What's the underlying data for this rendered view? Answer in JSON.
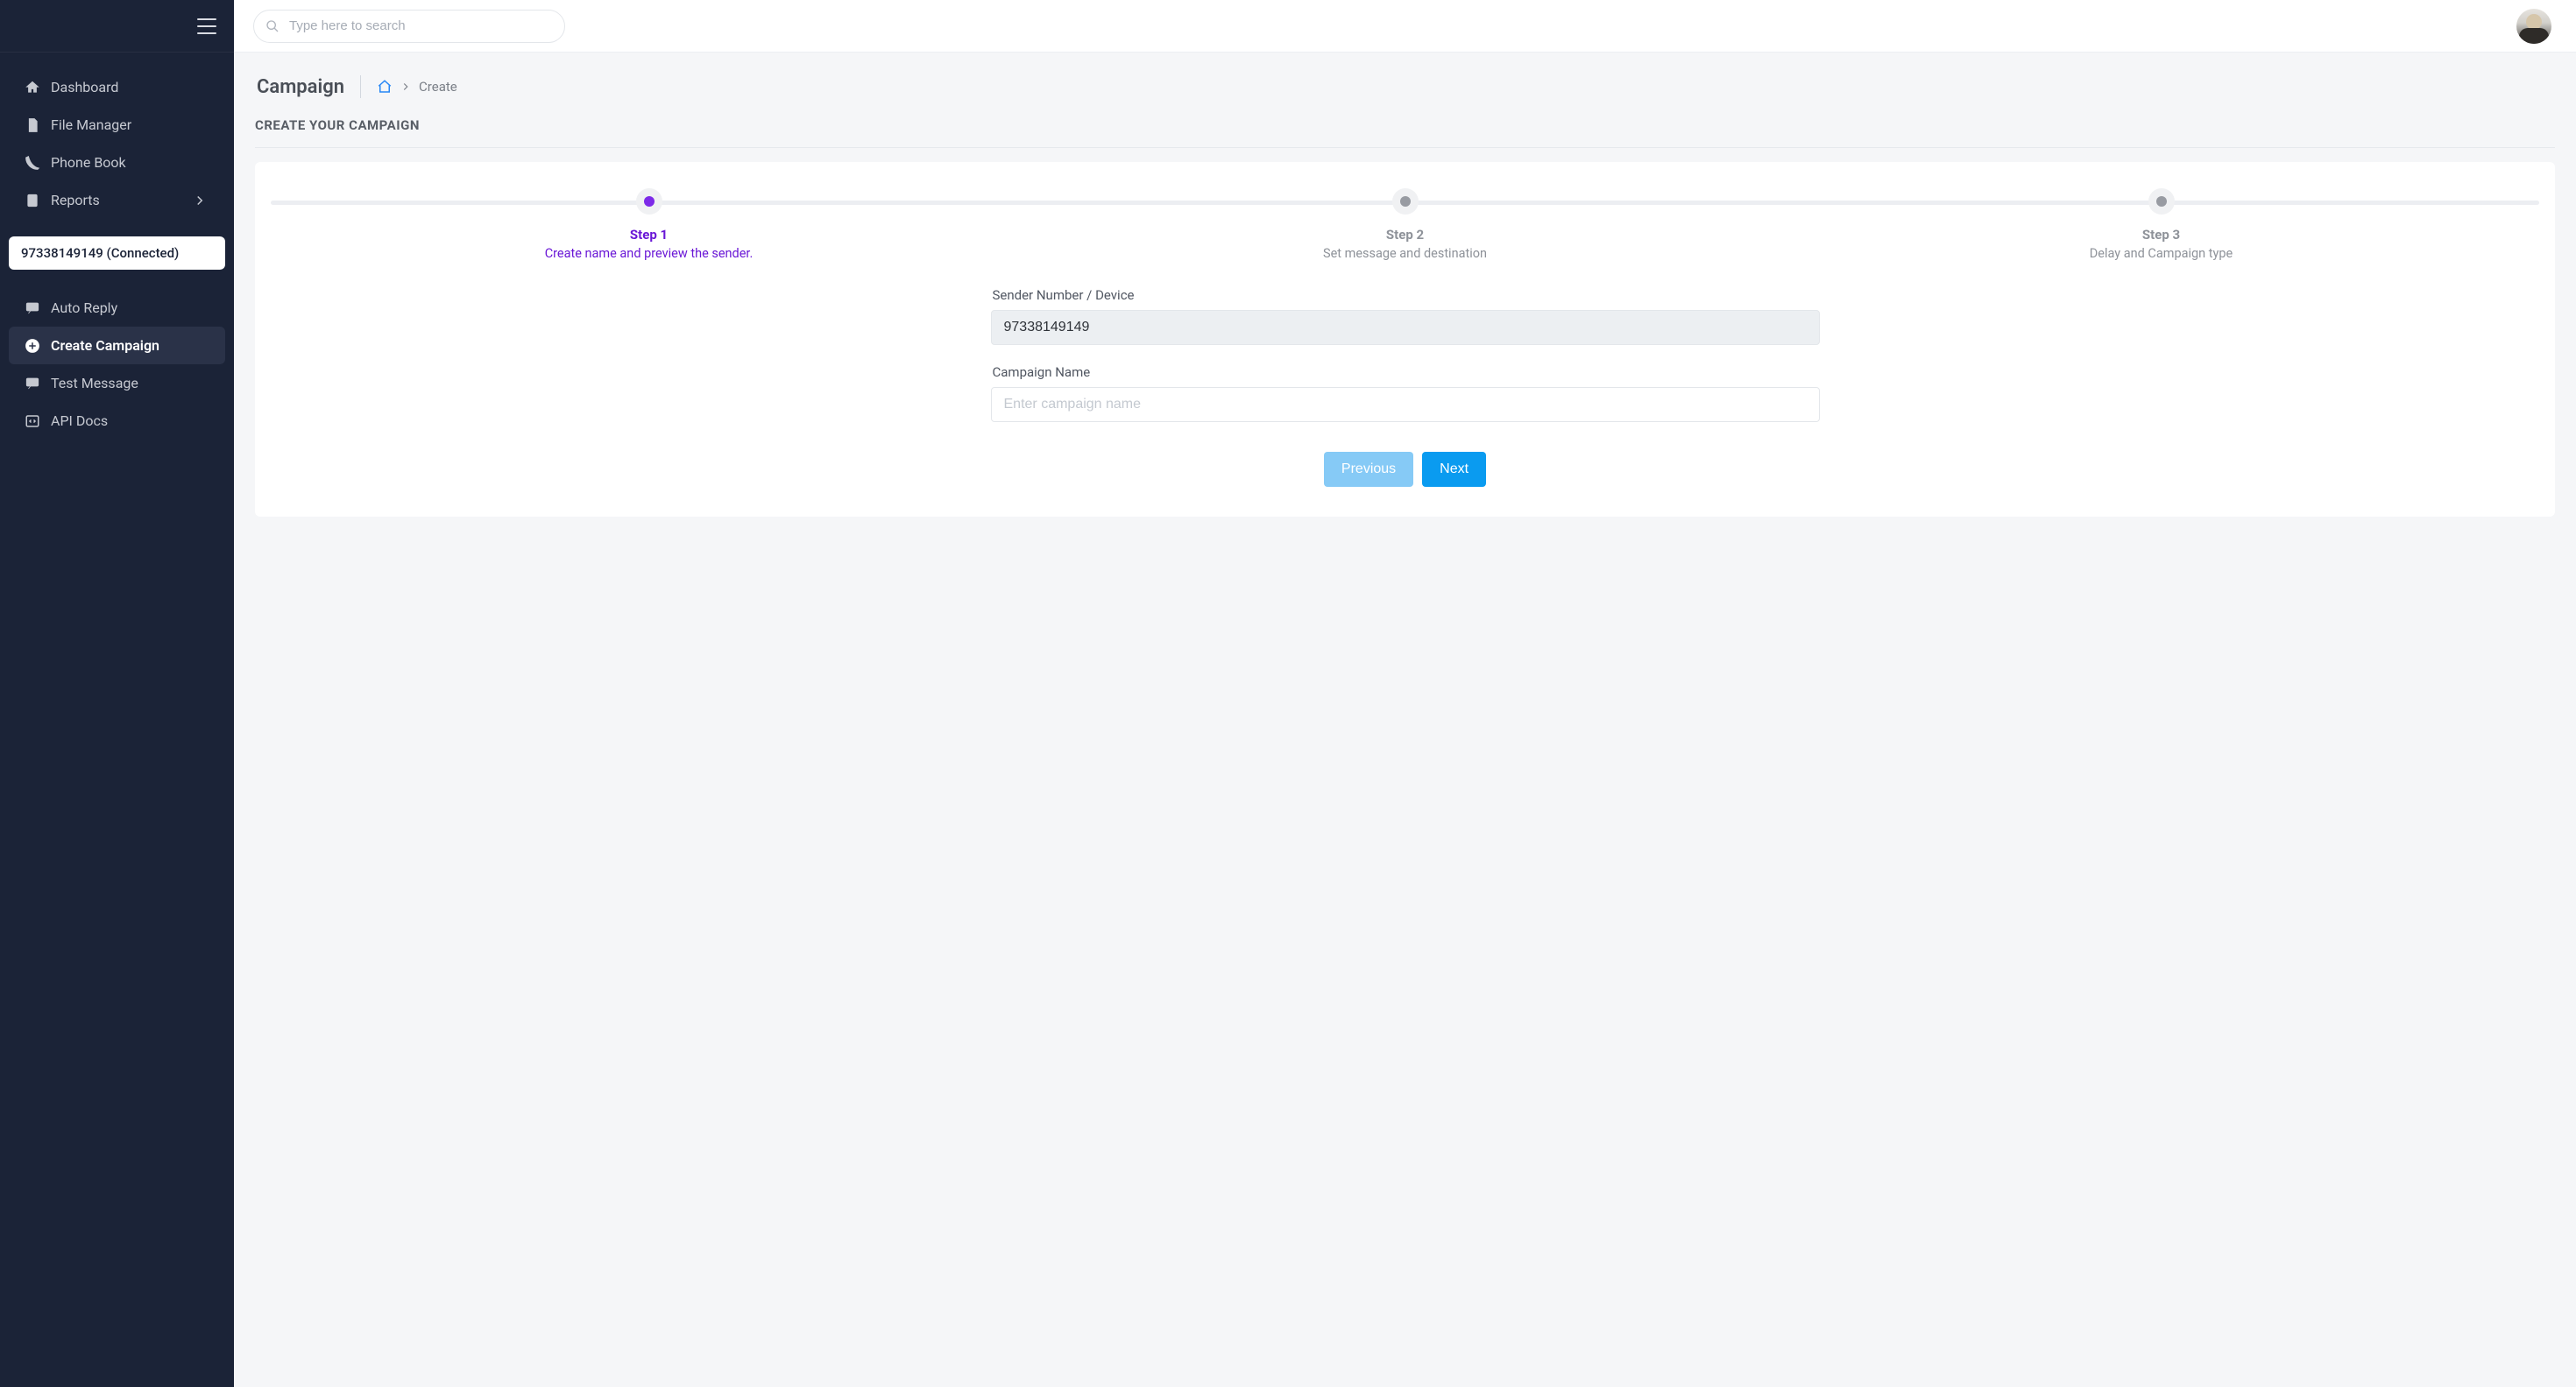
{
  "search": {
    "placeholder": "Type here to search"
  },
  "sidebar": {
    "items": [
      {
        "label": "Dashboard"
      },
      {
        "label": "File Manager"
      },
      {
        "label": "Phone Book"
      },
      {
        "label": "Reports"
      }
    ],
    "device": "97338149149 (Connected)",
    "items2": [
      {
        "label": "Auto Reply"
      },
      {
        "label": "Create Campaign"
      },
      {
        "label": "Test Message"
      },
      {
        "label": "API Docs"
      }
    ]
  },
  "page": {
    "title": "Campaign",
    "crumb_current": "Create",
    "section": "CREATE YOUR CAMPAIGN"
  },
  "stepper": [
    {
      "title": "Step 1",
      "desc": "Create name and preview the sender."
    },
    {
      "title": "Step 2",
      "desc": "Set message and destination"
    },
    {
      "title": "Step 3",
      "desc": "Delay and Campaign type"
    }
  ],
  "form": {
    "sender_label": "Sender Number / Device",
    "sender_value": "97338149149",
    "name_label": "Campaign Name",
    "name_placeholder": "Enter campaign name"
  },
  "buttons": {
    "prev": "Previous",
    "next": "Next"
  }
}
